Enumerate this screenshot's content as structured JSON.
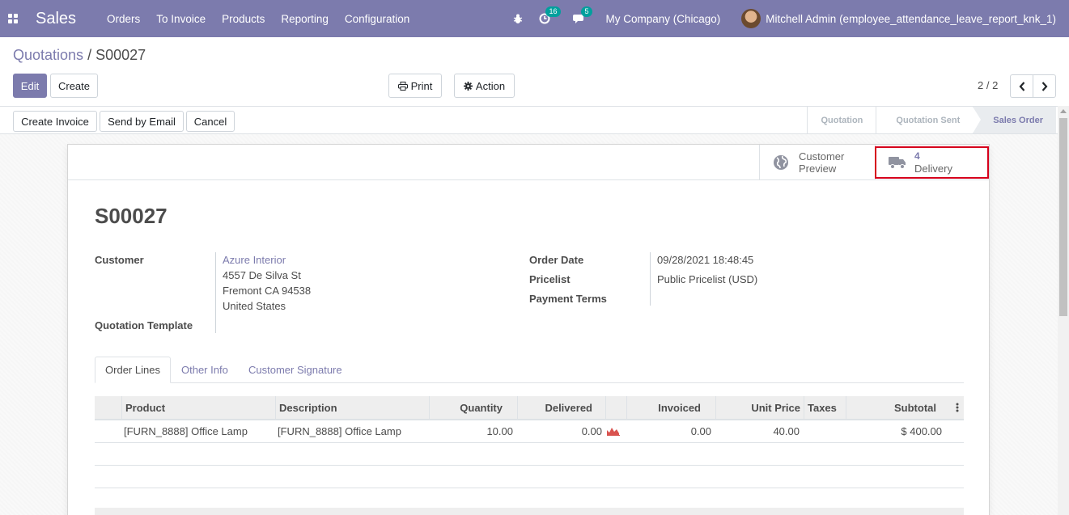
{
  "navbar": {
    "app_name": "Sales",
    "menu": [
      "Orders",
      "To Invoice",
      "Products",
      "Reporting",
      "Configuration"
    ],
    "activity_count": "16",
    "message_count": "5",
    "company": "My Company (Chicago)",
    "user": "Mitchell Admin (employee_attendance_leave_report_knk_1)"
  },
  "breadcrumb": {
    "parent": "Quotations",
    "separator": "/",
    "current": "S00027"
  },
  "toolbar": {
    "edit": "Edit",
    "create": "Create",
    "print": "Print",
    "action": "Action"
  },
  "pager": {
    "value": "2 / 2"
  },
  "statusbar": {
    "buttons": [
      "Create Invoice",
      "Send by Email",
      "Cancel"
    ],
    "stages": [
      "Quotation",
      "Quotation Sent",
      "Sales Order"
    ],
    "active_stage": "Sales Order"
  },
  "smart_buttons": {
    "preview_line1": "Customer",
    "preview_line2": "Preview",
    "delivery_count": "4",
    "delivery_label": "Delivery"
  },
  "form": {
    "name": "S00027",
    "customer_label": "Customer",
    "customer_name": "Azure Interior",
    "address": [
      "4557 De Silva St",
      "Fremont CA 94538",
      "United States"
    ],
    "quotation_template_label": "Quotation Template",
    "order_date_label": "Order Date",
    "order_date": "09/28/2021 18:48:45",
    "pricelist_label": "Pricelist",
    "pricelist": "Public Pricelist (USD)",
    "payment_terms_label": "Payment Terms"
  },
  "tabs": [
    "Order Lines",
    "Other Info",
    "Customer Signature"
  ],
  "order_lines": {
    "columns": [
      "Product",
      "Description",
      "Quantity",
      "Delivered",
      "Invoiced",
      "Unit Price",
      "Taxes",
      "Subtotal"
    ],
    "rows": [
      {
        "product": "[FURN_8888] Office Lamp",
        "description": "[FURN_8888] Office Lamp",
        "quantity": "10.00",
        "delivered": "0.00",
        "invoiced": "0.00",
        "unit_price": "40.00",
        "taxes": "",
        "subtotal": "$ 400.00"
      }
    ]
  },
  "colors": {
    "brand": "#7c7bad",
    "highlight": "#d6001c",
    "badge": "#00a09d"
  }
}
